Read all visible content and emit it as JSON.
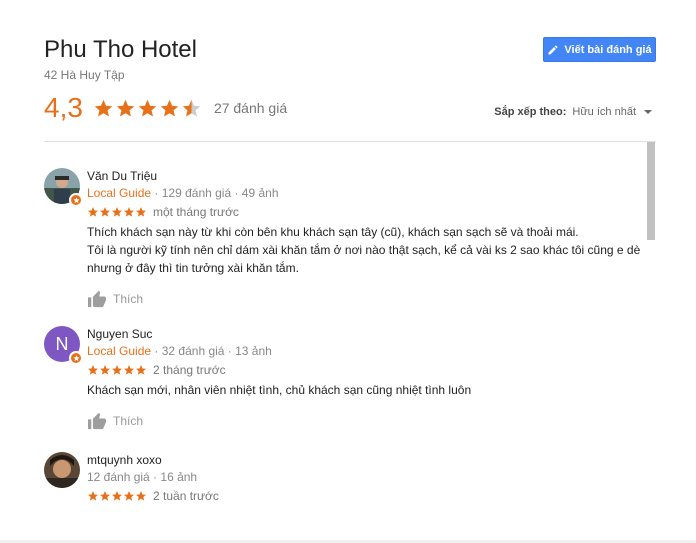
{
  "hotel": {
    "name": "Phu Tho Hotel",
    "address": "42 Hà Huy Tập"
  },
  "write_review_label": "Viết bài đánh giá",
  "rating": {
    "value": "4,3",
    "stars": 4.3,
    "count_label": "27 đánh giá"
  },
  "sort": {
    "label": "Sắp xếp theo:",
    "value": "Hữu ích nhất"
  },
  "colors": {
    "star": "#e7711b",
    "accent": "#4285f4",
    "guide": "#e7711b"
  },
  "reviews": [
    {
      "name": "Văn Du Triệu",
      "guide": "Local Guide",
      "meta": "129 đánh giá · 49 ảnh",
      "rating": 5,
      "date": "một tháng trước",
      "lines": [
        "Thích khách sạn này từ khi còn bên khu khách sạn tây (cũ), khách sạn sạch sẽ và thoải mái.",
        "Tôi là người kỹ tính nên chỉ dám xài khăn tắm ở nơi nào thật sạch, kể cả vài ks 2 sao khác tôi cũng e dè",
        "nhưng ở đây thì tin tưởng xài khăn tắm."
      ],
      "like_label": "Thích",
      "avatar": "photo"
    },
    {
      "name": "Nguyen Suc",
      "guide": "Local Guide",
      "meta": "32 đánh giá · 13 ảnh",
      "rating": 5,
      "date": "2 tháng trước",
      "lines": [
        "Khách sạn mới, nhân viên nhiệt tình, chủ khách sạn cũng nhiệt tình luôn"
      ],
      "like_label": "Thích",
      "avatar_letter": "N"
    },
    {
      "name": "mtquynh xoxo",
      "guide": "",
      "meta": "12 đánh giá · 16 ảnh",
      "rating": 5,
      "date": "2 tuần trước",
      "lines": [],
      "avatar": "photo"
    }
  ]
}
